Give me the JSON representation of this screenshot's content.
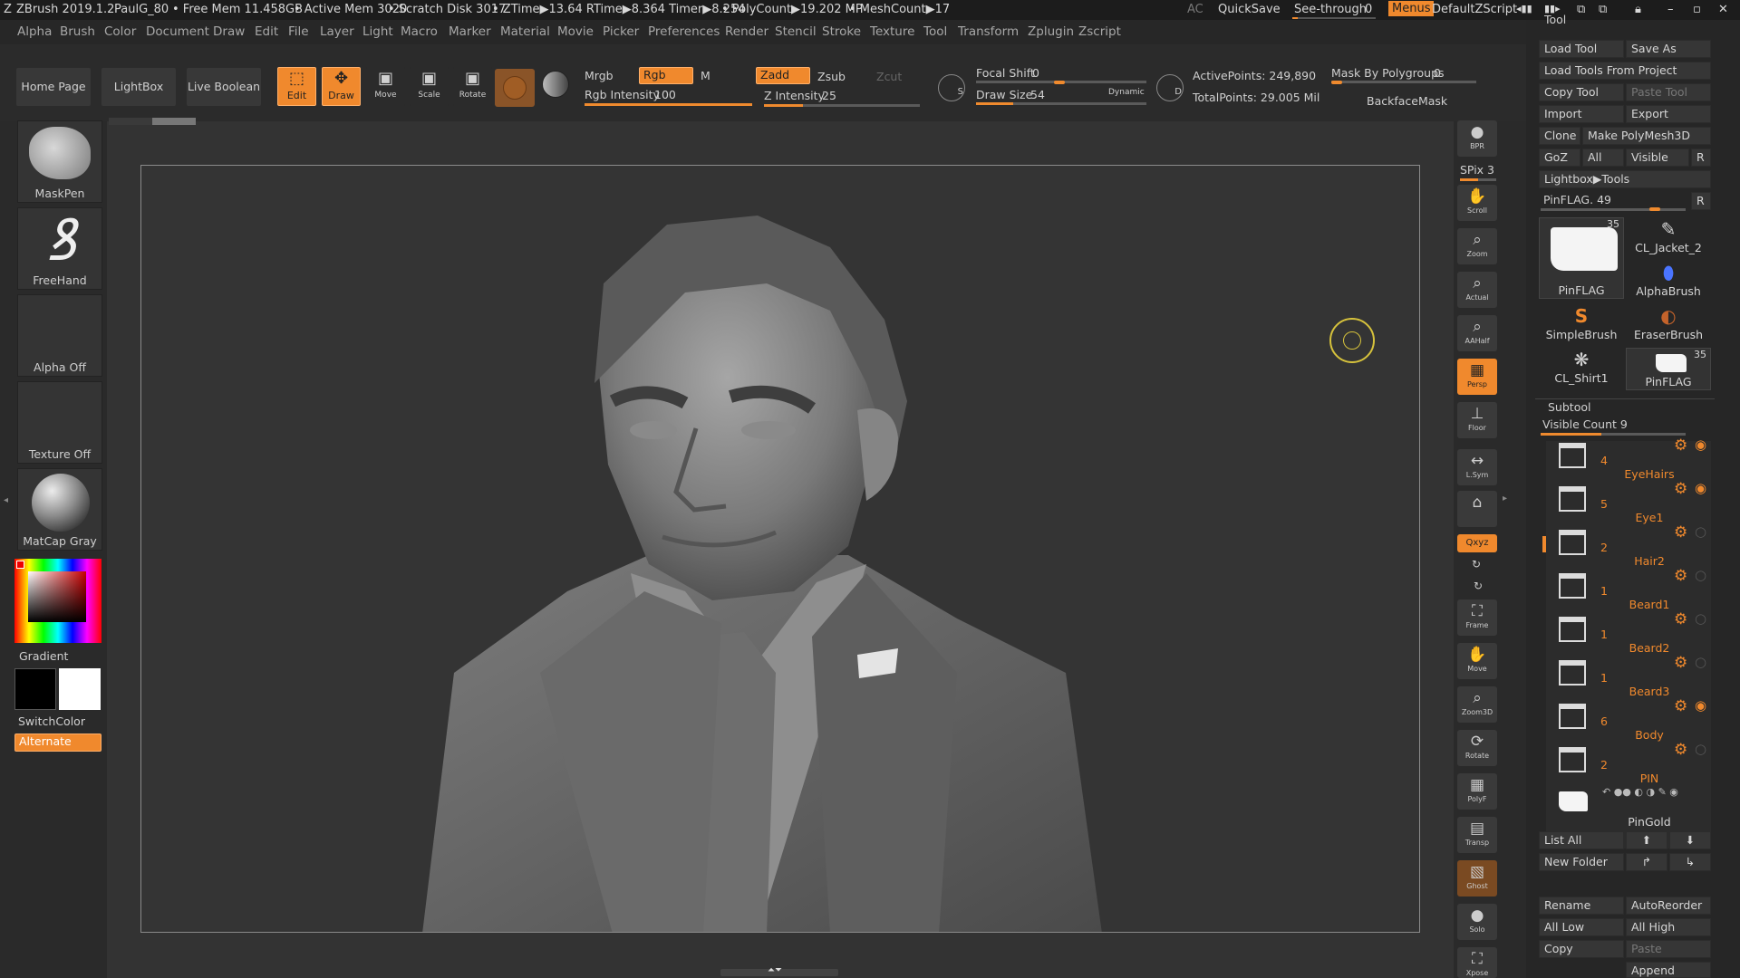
{
  "titlebar": {
    "app": "ZBrush 2019.1.2",
    "user": "PaulG_80",
    "free_mem": "• Free Mem 11.458GB",
    "active_mem": "• Active Mem 3020",
    "scratch": "• Scratch Disk 3017",
    "ztime": "• ZTime▶13.64 RTime▶8.364 Timer▶8.254",
    "polycount": "• PolyCount▶19.202 MP",
    "meshcount": "• MeshCount▶17",
    "ac": "AC",
    "quicksave": "QuickSave",
    "see_through": "See-through",
    "see_through_value": "0",
    "menus": "Menus",
    "script": "DefaultZScript"
  },
  "menubar": [
    "Alpha",
    "Brush",
    "Color",
    "Document",
    "Draw",
    "Edit",
    "File",
    "Layer",
    "Light",
    "Macro",
    "Marker",
    "Material",
    "Movie",
    "Picker",
    "Preferences",
    "Render",
    "Stencil",
    "Stroke",
    "Texture",
    "Tool",
    "Transform",
    "Zplugin",
    "Zscript"
  ],
  "toolbar": {
    "home_page": "Home Page",
    "lightbox": "LightBox",
    "live_boolean": "Live Boolean",
    "edit": "Edit",
    "draw": "Draw",
    "move": "Move",
    "scale": "Scale",
    "rotate": "Rotate",
    "mrgb": "Mrgb",
    "rgb": "Rgb",
    "m": "M",
    "rgb_intensity_label": "Rgb Intensity",
    "rgb_intensity": "100",
    "zadd": "Zadd",
    "zsub": "Zsub",
    "zcut": "Zcut",
    "z_intensity_label": "Z Intensity",
    "z_intensity": "25",
    "focal_shift_label": "Focal Shift",
    "focal_shift": "0",
    "draw_size_label": "Draw Size",
    "draw_size": "54",
    "dynamic": "Dynamic",
    "active_points": "ActivePoints: 249,890",
    "total_points": "TotalPoints: 29.005 Mil",
    "mask_polygroups_label": "Mask By Polygroups",
    "mask_polygroups": "0",
    "backface_mask": "BackfaceMask"
  },
  "leftshelf": {
    "brush": "MaskPen",
    "stroke": "FreeHand",
    "alpha": "Alpha Off",
    "texture": "Texture Off",
    "material": "MatCap Gray",
    "gradient": "Gradient",
    "switch_color": "SwitchColor",
    "alternate": "Alternate"
  },
  "rightshelf": [
    {
      "label": "BPR",
      "icon": "sphere-icon"
    },
    {
      "label": "SPix 3",
      "icon": "spix-slider"
    },
    {
      "label": "Scroll",
      "icon": "hand-icon"
    },
    {
      "label": "Zoom",
      "icon": "magnifier-icon"
    },
    {
      "label": "Actual",
      "icon": "magnifier-icon"
    },
    {
      "label": "AAHalf",
      "icon": "magnifier-icon"
    },
    {
      "label": "Persp",
      "icon": "grid-icon"
    },
    {
      "label": "Floor",
      "icon": "floor-icon"
    },
    {
      "label": "L.Sym",
      "icon": "sym-icon"
    },
    {
      "label": "",
      "icon": "lock-icon"
    },
    {
      "label": "Qxyz",
      "icon": "xyz-icon"
    },
    {
      "label": "Frame",
      "icon": "frame-icon"
    },
    {
      "label": "Move",
      "icon": "hand-icon"
    },
    {
      "label": "Zoom3D",
      "icon": "magnifier-icon"
    },
    {
      "label": "Rotate",
      "icon": "rotate-icon"
    },
    {
      "label": "PolyF",
      "icon": "polyframe-icon"
    },
    {
      "label": "Transp",
      "icon": "transp-icon"
    },
    {
      "label": "Ghost",
      "icon": "ghost-icon"
    },
    {
      "label": "Solo",
      "icon": "solo-icon"
    },
    {
      "label": "Xpose",
      "icon": "xpose-icon"
    }
  ],
  "tool_panel": {
    "title": "Tool",
    "load_tool": "Load Tool",
    "save_as": "Save As",
    "load_from_project": "Load Tools From Project",
    "copy_tool": "Copy Tool",
    "paste_tool": "Paste Tool",
    "import": "Import",
    "export": "Export",
    "clone": "Clone",
    "make_polymesh": "Make PolyMesh3D",
    "goz": "GoZ",
    "all": "All",
    "visible": "Visible",
    "r": "R",
    "lightbox_tools": "Lightbox▶Tools",
    "pinflag": "PinFLAG. 49",
    "thumbs": [
      {
        "name": "PinFLAG",
        "badge": "35"
      },
      {
        "name": "CL_Jacket_2"
      },
      {
        "name": "AlphaBrush"
      },
      {
        "name": "SimpleBrush"
      },
      {
        "name": "EraserBrush"
      },
      {
        "name": "CL_Shirt1"
      },
      {
        "name": "PinFLAG",
        "badge": "35"
      }
    ]
  },
  "subtool": {
    "title": "Subtool",
    "visible_count": "Visible Count 9",
    "items": [
      {
        "num": "4",
        "name": "EyeHairs"
      },
      {
        "num": "5",
        "name": "Eye1"
      },
      {
        "num": "2",
        "name": "Hair2"
      },
      {
        "num": "1",
        "name": "Beard1"
      },
      {
        "num": "1",
        "name": "Beard2"
      },
      {
        "num": "1",
        "name": "Beard3"
      },
      {
        "num": "6",
        "name": "Body"
      },
      {
        "num": "2",
        "name": "PIN"
      },
      {
        "num": "",
        "name": "PinGold"
      }
    ],
    "list_all": "List All",
    "new_folder": "New Folder",
    "rename": "Rename",
    "auto_reorder": "AutoReorder",
    "all_low": "All Low",
    "all_high": "All High",
    "copy": "Copy",
    "paste": "Paste",
    "append": "Append"
  },
  "colors": {
    "accent": "#f0892d",
    "primary_color": "#000000",
    "secondary_color": "#ffffff"
  }
}
